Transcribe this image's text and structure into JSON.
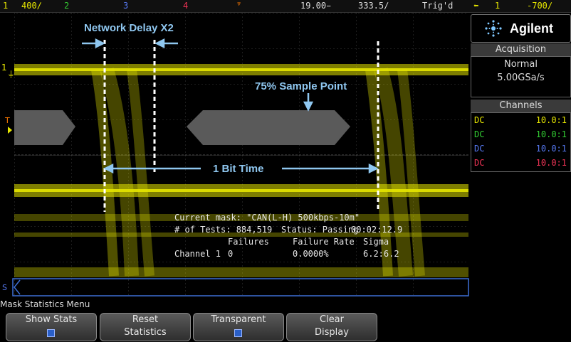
{
  "topbar": {
    "ch1_num": "1",
    "ch1_scale": "400∕",
    "ch2_num": "2",
    "ch3_num": "3",
    "ch4_num": "4",
    "timebase_delay": "19.00̵",
    "timebase_scale": "333.5∕",
    "trigger_state": "Trig'd",
    "trigger_source": "1",
    "trigger_level": "-700∕"
  },
  "colors": {
    "ch1": "#e6e600",
    "ch2": "#33cc33",
    "ch3": "#5577ee",
    "ch4": "#ee3355",
    "annotation": "#8fc7f0",
    "mask": "#5a5a5a",
    "trigger_marker": "#ff7a00"
  },
  "annotations": {
    "network_delay": "Network Delay X2",
    "sample_point": "75% Sample Point",
    "bit_time": "1 Bit Time"
  },
  "mask_stats": {
    "current_mask": "Current mask: \"CAN(L-H) 500kbps-10m\"",
    "tests": "# of Tests: 884,519",
    "status": "Status: Passing",
    "elapsed": "00:02:12.9",
    "col_failures": "Failures",
    "col_failure_rate": "Failure Rate",
    "col_sigma": "Sigma",
    "row_label": "Channel 1",
    "row_failures": "0",
    "row_failure_rate": "0.0000%",
    "row_sigma": "6.2:6.2"
  },
  "markers": {
    "ch1_ground": "1",
    "trigger": "T",
    "serial": "S"
  },
  "sidepanel": {
    "brand": "Agilent",
    "acquisition_title": "Acquisition",
    "acq_mode": "Normal",
    "sample_rate": "5.00GSa/s",
    "channels_title": "Channels",
    "channels": [
      {
        "coupling": "DC",
        "probe": "10.0:1"
      },
      {
        "coupling": "DC",
        "probe": "10.0:1"
      },
      {
        "coupling": "DC",
        "probe": "10.0:1"
      },
      {
        "coupling": "DC",
        "probe": "10.0:1"
      }
    ]
  },
  "menu": {
    "title": "Mask Statistics Menu",
    "show_stats_label": "Show Stats",
    "reset_label_1": "Reset",
    "reset_label_2": "Statistics",
    "transparent_label": "Transparent",
    "clear_label_1": "Clear",
    "clear_label_2": "Display"
  }
}
